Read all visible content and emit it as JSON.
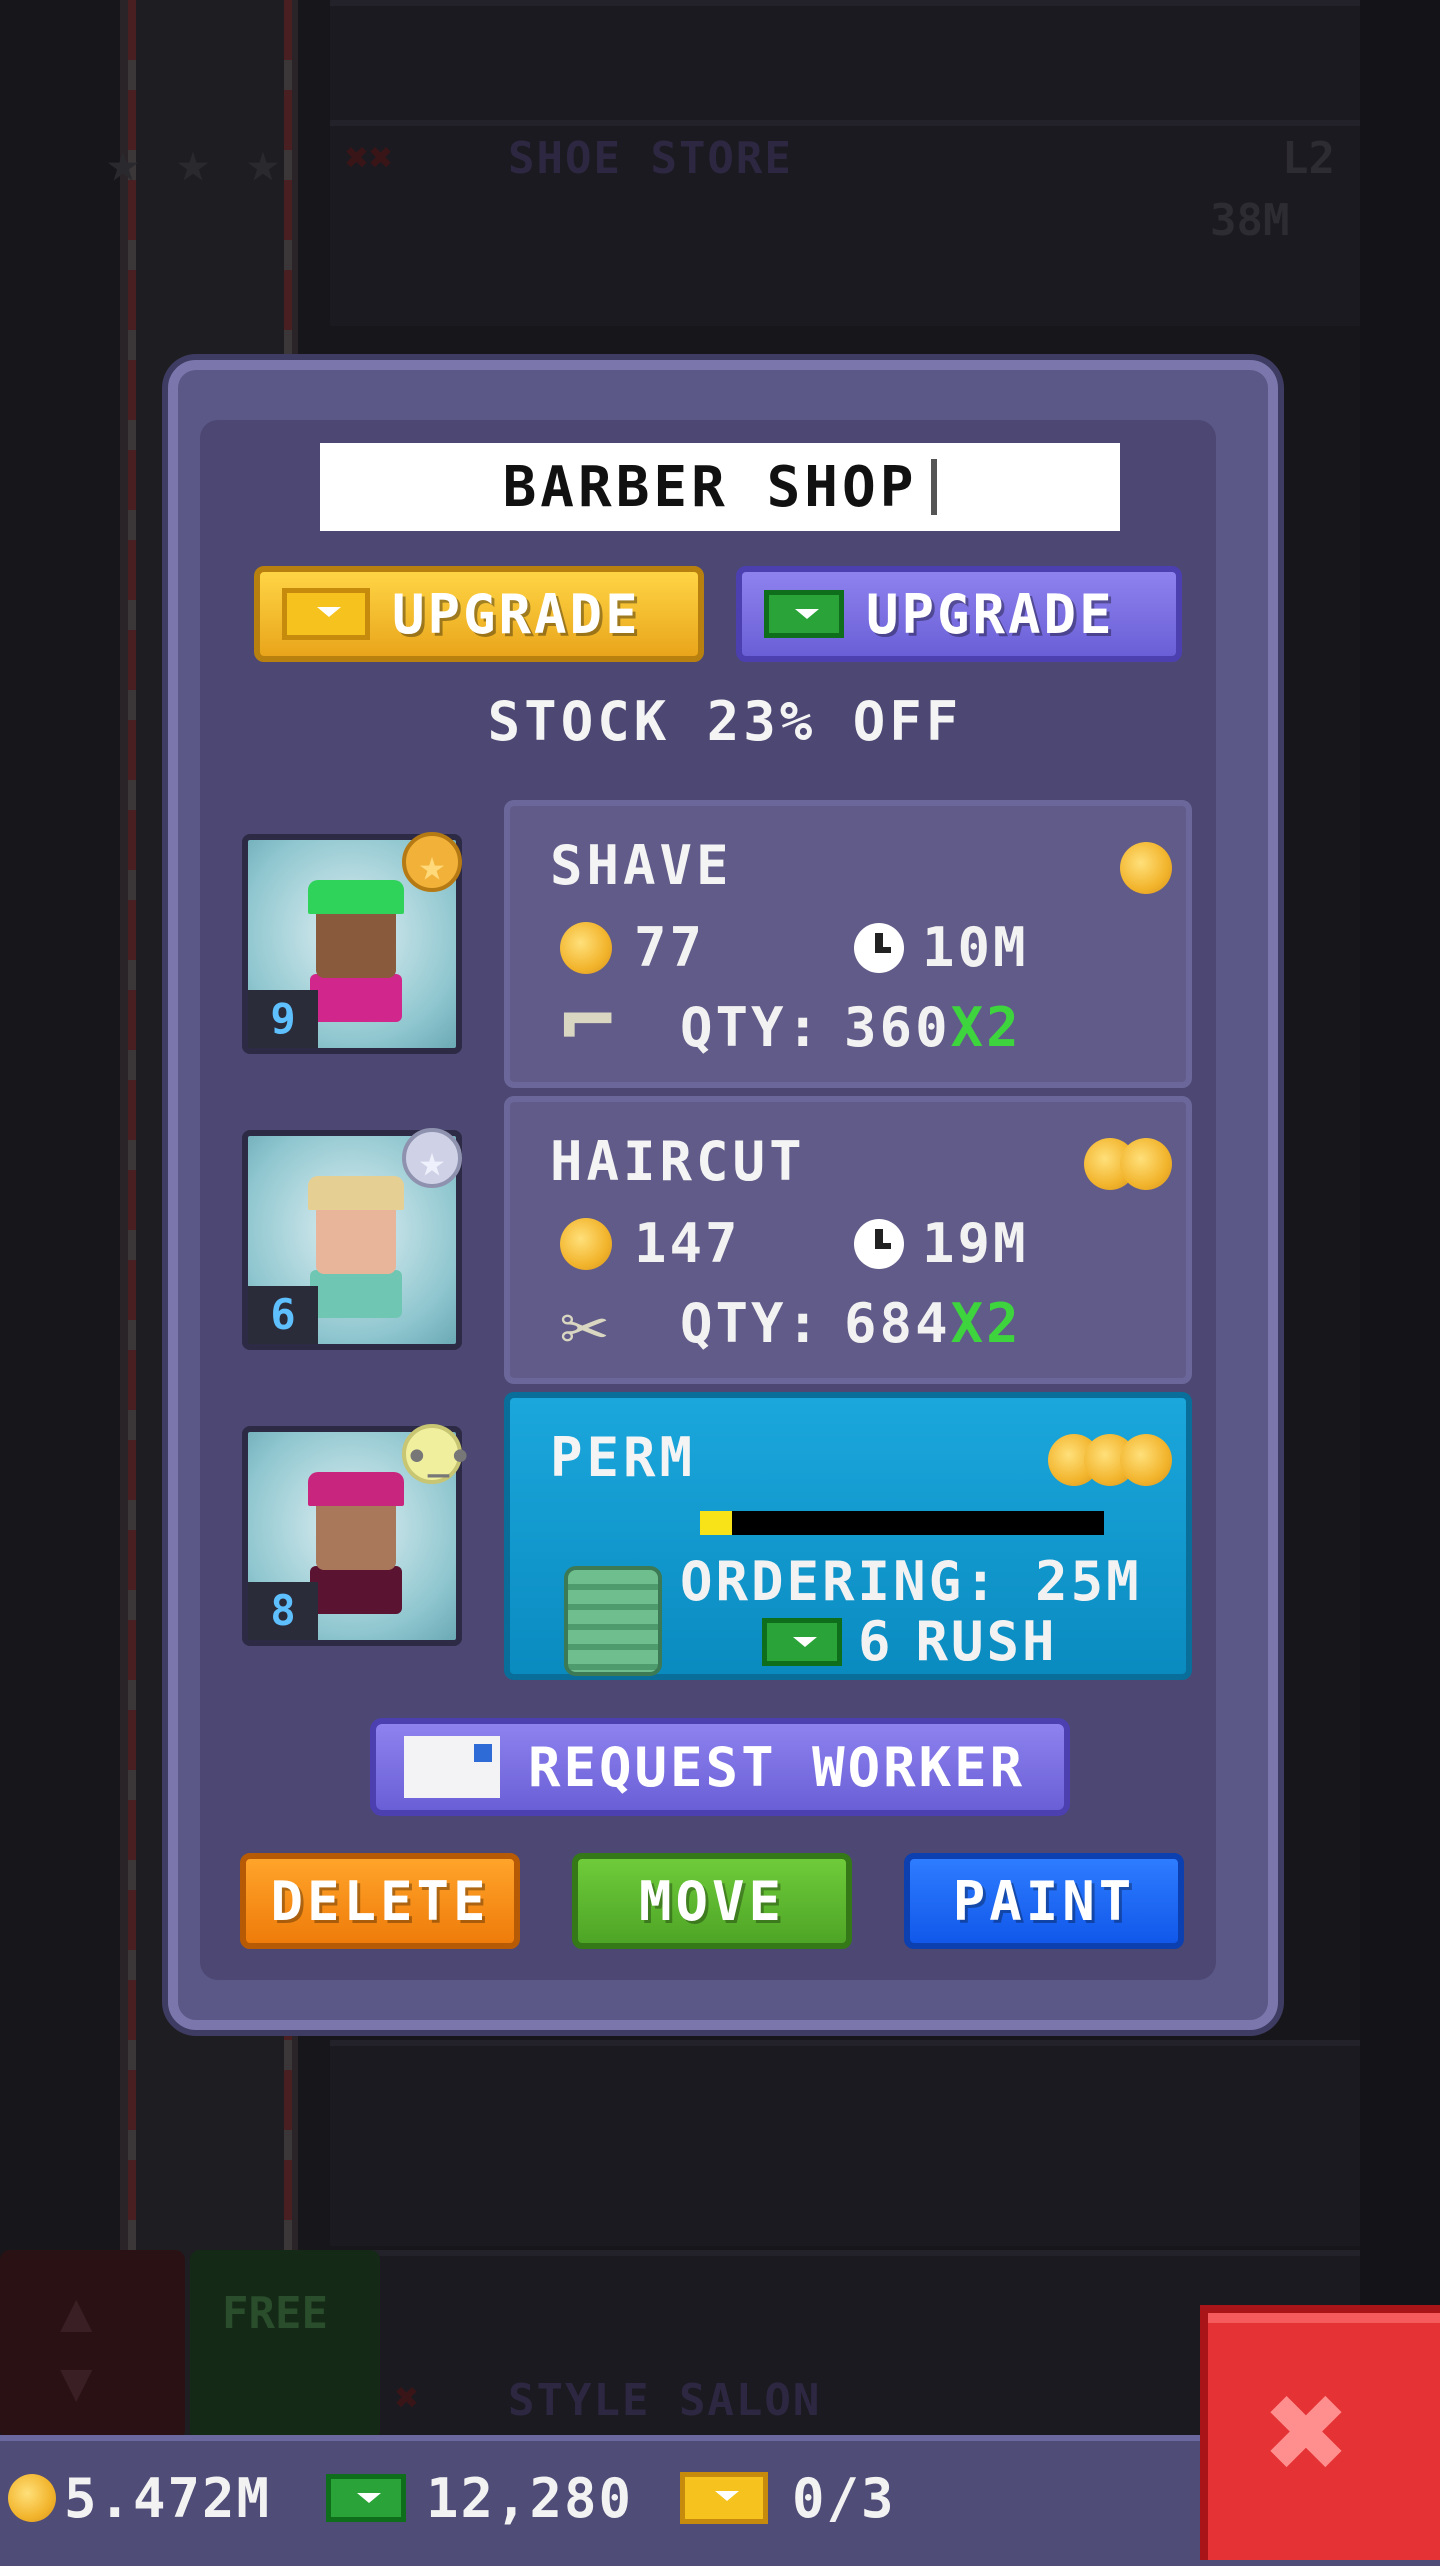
{
  "background": {
    "floors": [
      {
        "label": "SHOE STORE",
        "level": "L2",
        "value": "38M"
      },
      {
        "label": "STYLE SALON"
      }
    ],
    "controls": {
      "free_label": "FREE"
    }
  },
  "dialog": {
    "title": "BARBER SHOP",
    "upgrade_coins_label": "UPGRADE",
    "upgrade_bux_label": "UPGRADE",
    "stock_discount": "STOCK 23% OFF",
    "products": [
      {
        "name": "SHAVE",
        "price": "77",
        "time": "10M",
        "qty_label": "QTY:",
        "qty": "360",
        "multiplier": "X2",
        "tier_coins": 1,
        "tool_icon": "razor-icon",
        "worker": {
          "level": "9",
          "badge": "gold-star",
          "hair_color": "#2fd35a",
          "skin_color": "#8a5a3c",
          "shirt_color": "#d1268b"
        }
      },
      {
        "name": "HAIRCUT",
        "price": "147",
        "time": "19M",
        "qty_label": "QTY:",
        "qty": "684",
        "multiplier": "X2",
        "tier_coins": 2,
        "tool_icon": "scissors-icon",
        "worker": {
          "level": "6",
          "badge": "silver-star",
          "hair_color": "#e6cf92",
          "skin_color": "#e8b49a",
          "shirt_color": "#6fc7b3"
        }
      },
      {
        "name": "PERM",
        "status": "ORDERING: 25M",
        "rush_cost": "6",
        "rush_label": "RUSH",
        "progress": 0.08,
        "tier_coins": 3,
        "tool_icon": "cash-stack-icon",
        "worker": {
          "level": "8",
          "badge": "neutral-face",
          "hair_color": "#c8267e",
          "skin_color": "#a9785a",
          "shirt_color": "#5a1330"
        }
      }
    ],
    "request_worker_label": "REQUEST WORKER",
    "actions": {
      "delete": "DELETE",
      "move": "MOVE",
      "paint": "PAINT"
    }
  },
  "status_bar": {
    "coins": "5.472M",
    "bux": "12,280",
    "tickets": "0/3"
  },
  "colors": {
    "dialog_bg": "#5b5786",
    "gold_button": "#f5c21e",
    "purple_button": "#7a6ee3",
    "active_product": "#1ba7dc",
    "delete": "#ef7c0a",
    "move": "#4ea526",
    "paint": "#1158ea",
    "close": "#e53235"
  }
}
